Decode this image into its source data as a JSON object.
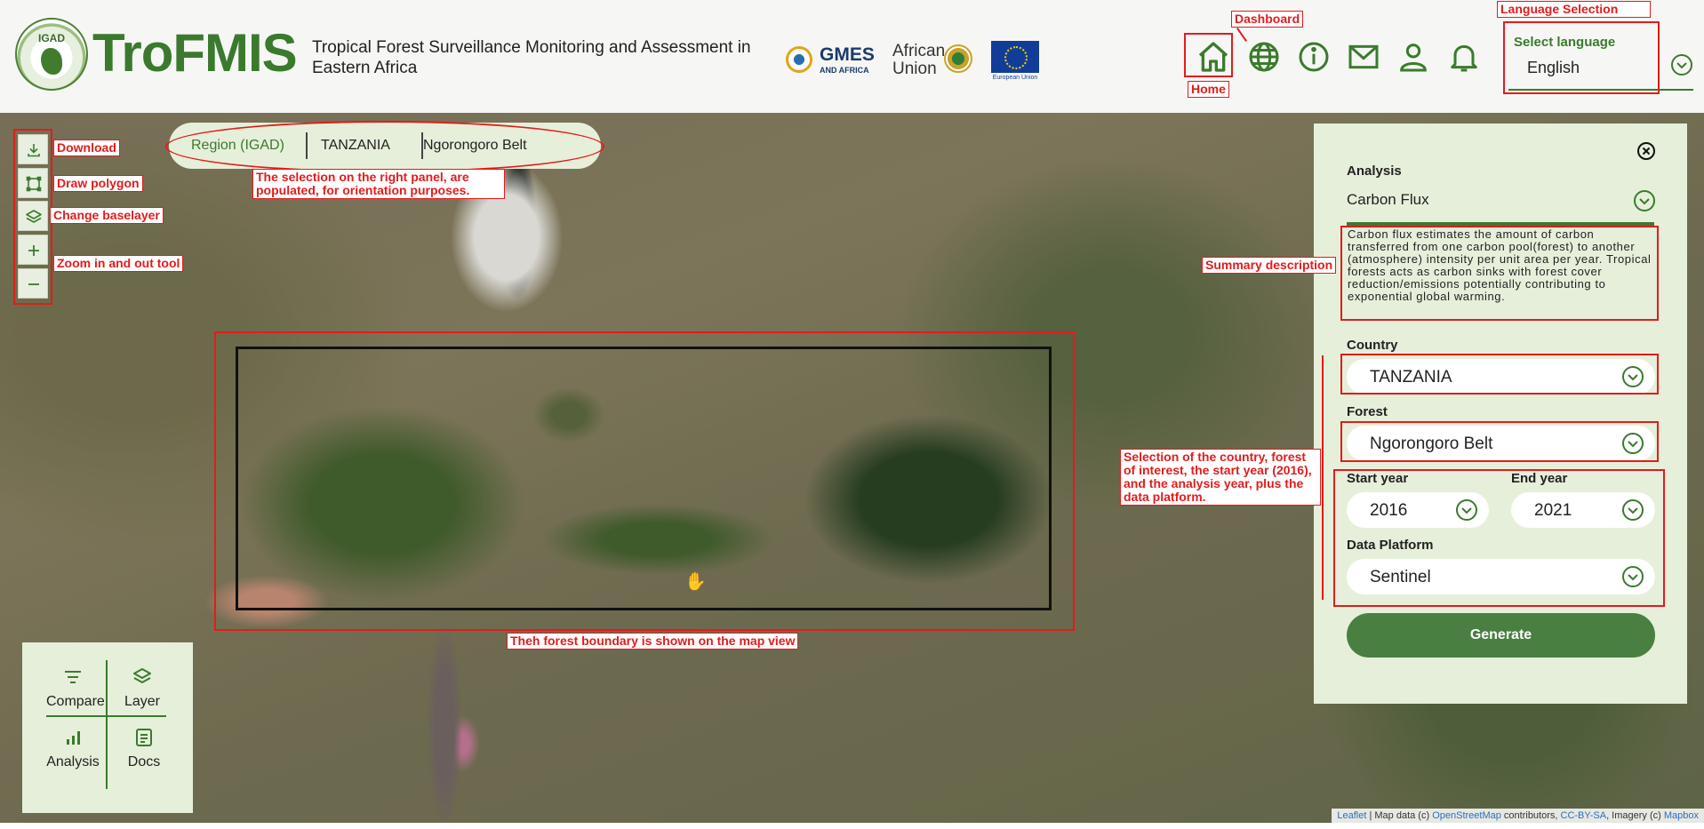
{
  "header": {
    "logo_text": "IGAD",
    "brand": "TroFMIS",
    "subtitle": "Tropical Forest Surveillance Monitoring and Assessment in Eastern Africa",
    "partners": {
      "gmes_main": "GMES",
      "gmes_sub": "AND AFRICA",
      "au": "African Union",
      "eu": "European Union"
    },
    "nav_icons": [
      "home-icon",
      "globe-icon",
      "info-icon",
      "mail-icon",
      "user-icon",
      "bell-icon"
    ],
    "language": {
      "label": "Select language",
      "value": "English"
    }
  },
  "breadcrumb": {
    "region": "Region (IGAD)",
    "country": "TANZANIA",
    "forest": "Ngorongoro Belt"
  },
  "toolbar": {
    "tools": [
      "download-icon",
      "draw-polygon-icon",
      "layers-icon",
      "zoom-in-icon",
      "zoom-out-icon"
    ]
  },
  "bottom_panel": {
    "compare": "Compare",
    "layer": "Layer",
    "analysis": "Analysis",
    "docs": "Docs"
  },
  "side_panel": {
    "analysis_label": "Analysis",
    "analysis_value": "Carbon Flux",
    "description": "Carbon flux estimates the amount of carbon transferred from one carbon pool(forest) to another (atmosphere) intensity per unit area per year. Tropical forests acts as carbon sinks with forest cover reduction/emissions potentially contributing to exponential global warming.",
    "country_label": "Country",
    "country_value": "TANZANIA",
    "forest_label": "Forest",
    "forest_value": "Ngorongoro Belt",
    "start_year_label": "Start year",
    "start_year_value": "2016",
    "end_year_label": "End year",
    "end_year_value": "2021",
    "platform_label": "Data Platform",
    "platform_value": "Sentinel",
    "generate": "Generate"
  },
  "attribution": {
    "leaflet": "Leaflet",
    "text1": " | Map data (c) ",
    "osm": "OpenStreetMap",
    "text2": " contributors, ",
    "license": "CC-BY-SA",
    "text3": ", Imagery (c) ",
    "mapbox": "Mapbox"
  },
  "annotations": {
    "dashboard": "Dashboard",
    "home": "Home",
    "language": "Language Selection",
    "download": "Download",
    "draw_polygon": "Draw polygon",
    "change_baselayer": "Change baselayer",
    "zoom": "Zoom in and out tool",
    "selection_note": "The selection on the right panel, are populated, for orientation purposes.",
    "summary": "Summary description",
    "selection_country": "Selection of the country, forest of interest, the start year (2016), and the analysis year, plus the data platform.",
    "forest_boundary": "Theh forest boundary is shown on the map view"
  },
  "colors": {
    "brand_green": "#3b7a2e",
    "panel_bg": "#e6efda",
    "generate_bg": "#4a7f42",
    "annotation_red": "#e21c1c"
  }
}
